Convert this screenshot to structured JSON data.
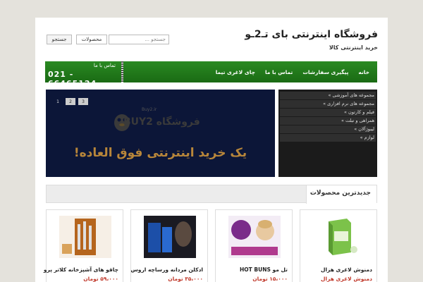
{
  "header": {
    "site_title": "فروشگاه اینترنتی بای تـ2ـو",
    "tagline": "خرید اینترنتی کالا"
  },
  "search": {
    "button_label": "جستجو",
    "category_value": "محصولات",
    "input_placeholder": "جستجو ..."
  },
  "nav": {
    "items": [
      {
        "label": "خانه"
      },
      {
        "label": "پیگیری سفارشات"
      },
      {
        "label": "تماس با ما"
      },
      {
        "label": "چای لاغری تیما"
      }
    ]
  },
  "contact": {
    "label": "تماس با ما",
    "phone": "021 - 66465124"
  },
  "slider": {
    "dots": [
      "3",
      "2",
      "1"
    ],
    "logo_text": "فروشگاه BUY2",
    "logo_small": "Buy2.ir",
    "banner_text": "یک خرید اینترنتی فوق العاده!"
  },
  "categories": [
    {
      "label": "مجموعه های آموزشی »"
    },
    {
      "label": "مجموعه های نرم افزاری »"
    },
    {
      "label": "فیلم و کارتون »"
    },
    {
      "label": "همراهی و تبلت »"
    },
    {
      "label": "لیبوژآلان »"
    },
    {
      "label": "لوازم »"
    }
  ],
  "new_products": {
    "title": "جدیدترین محصولات",
    "items": [
      {
        "name": "دمنوش لاغری هزال",
        "price": "دمنوش لاغری هزال"
      },
      {
        "name": "تل مو HOT BUNS",
        "price": "۱۵،۰۰۰ تومان"
      },
      {
        "name": "ادکلن مردانه ورساچه اروس",
        "price": "۳۵،۰۰۰ تومان"
      },
      {
        "name": "چاقو های آشپزخانه کلاتر پرو",
        "price": "۵۹،۰۰۰ تومان"
      }
    ]
  },
  "colors": {
    "nav_green": "#1f7a1a",
    "slider_bg": "#0c1638",
    "price_red": "#c0392b"
  }
}
